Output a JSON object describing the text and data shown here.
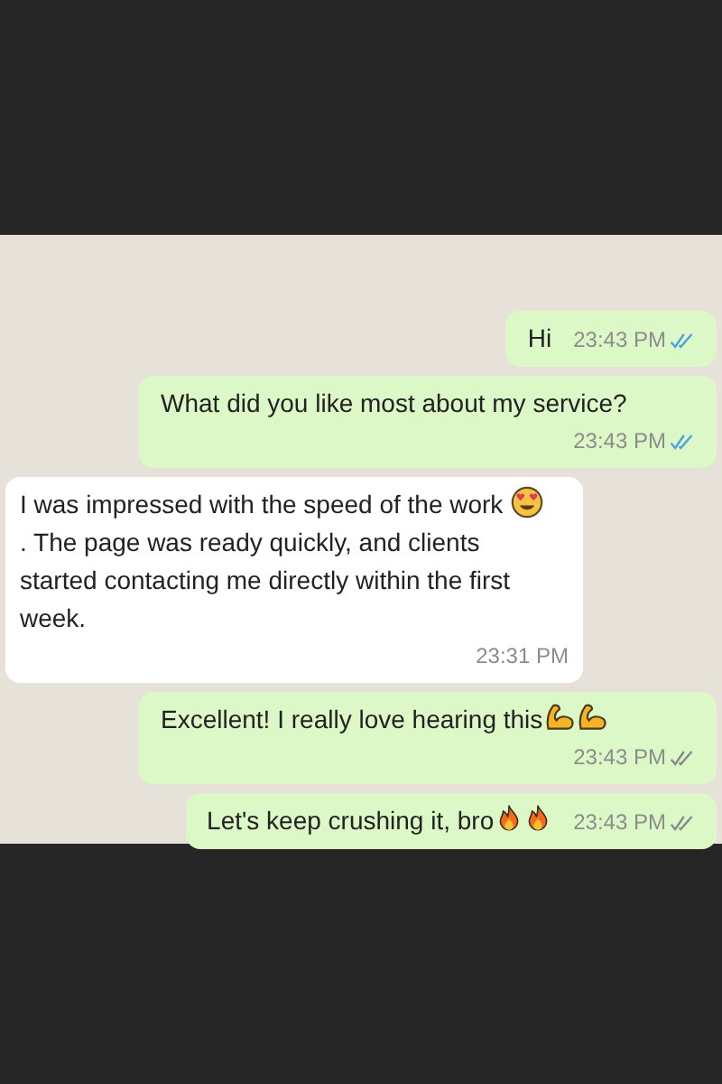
{
  "messages": [
    {
      "kind": "outgoing",
      "parts": [
        {
          "kind": "text",
          "text": "Hi"
        }
      ],
      "time": "23:43 PM",
      "read": true
    },
    {
      "kind": "outgoing",
      "parts": [
        {
          "kind": "text",
          "text": "What did you like most about my service?"
        }
      ],
      "time": "23:43 PM",
      "read": true
    },
    {
      "kind": "incoming",
      "parts": [
        {
          "kind": "text",
          "text": "I was impressed with the speed of the work "
        },
        {
          "kind": "heart-eyes"
        },
        {
          "kind": "text",
          "text": ". The page was ready quickly, and clients started contacting me directly within the first week."
        }
      ],
      "time": "23:31 PM"
    },
    {
      "kind": "outgoing",
      "parts": [
        {
          "kind": "text",
          "text": "Excellent! I really love hearing this"
        },
        {
          "kind": "biceps"
        },
        {
          "kind": "biceps"
        }
      ],
      "time": "23:43 PM",
      "read": false
    },
    {
      "kind": "outgoing",
      "parts": [
        {
          "kind": "text",
          "text": "Let's keep crushing it, bro"
        },
        {
          "kind": "fire"
        },
        {
          "kind": "fire"
        }
      ],
      "time": "23:43 PM",
      "read": false
    }
  ]
}
